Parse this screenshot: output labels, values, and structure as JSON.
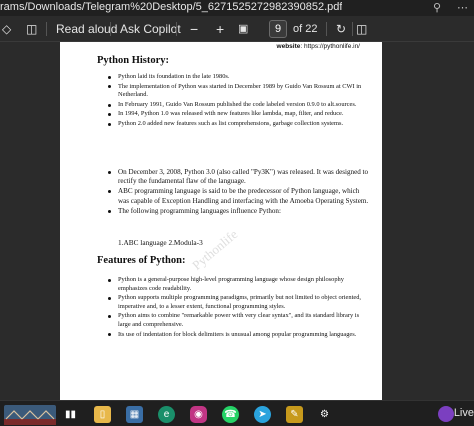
{
  "window": {
    "path": "rams/Downloads/Telegram%20Desktop/5_6271525272982390852.pdf"
  },
  "toolbar": {
    "read_aloud": "Read aloud",
    "ask_copilot": "Ask Copilot",
    "minus": "−",
    "plus": "+",
    "page_current": "9",
    "page_total": "of 22"
  },
  "document": {
    "website_label": "website",
    "website_url": ": https://pythonlife.in/",
    "history_heading": "Python History:",
    "history_items": [
      "Python laid its foundation in the late 1980s.",
      "The implementation of Python was started in December 1989 by Guido Van Rossum at CWI in Netherland.",
      "In February 1991, Guido Van Rossum published the code labeled version 0.9.0  to alt.sources.",
      "In 1994, Python 1.0 was released with new features like lambda, map, filter, and reduce.",
      "Python 2.0 added new features such as list comprehensions, garbage collection systems."
    ],
    "history_items_big": [
      "On December 3, 2008, Python 3.0 (also called \"Py3K\") was released. It was designed to rectify the fundamental flaw of the language.",
      "ABC programming language is said to be the predecessor of Python language, which was capable of Exception Handling and interfacing with the Amoeba Operating System.",
      "The following programming languages influence Python:"
    ],
    "languages_line": "1.ABC language  2.Modula-3",
    "features_heading": "Features of Python:",
    "features_items": [
      "Python is a general-purpose high-level programming language whose design philosophy emphasizes code readability.",
      "Python supports multiple programming paradigms, primarily but not limited to object oriented, imperative and, to a lesser extent, functional programming styles.",
      "Python aims to combine \"remarkable power with very clear syntax\", and its standard library is large and comprehensive.",
      "Its use of indentation for block delimiters is unusual among popular programming languages."
    ],
    "watermark": "Pythonlife"
  },
  "taskbar": {
    "live_label": "Live"
  }
}
